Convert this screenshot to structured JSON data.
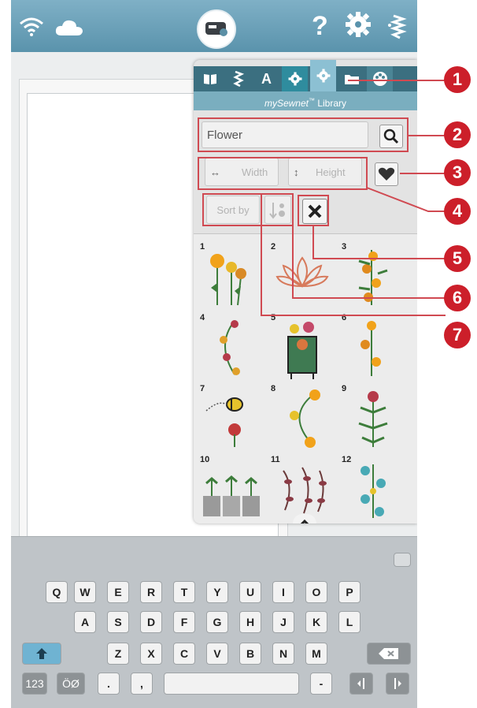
{
  "topbar": {
    "help_label": "?",
    "icons": [
      "wifi-icon",
      "cloud-icon",
      "machine-icon",
      "help-icon",
      "settings-icon",
      "stitch-icon"
    ]
  },
  "panel": {
    "tabs": [
      "book-icon",
      "stitch-icon",
      "A",
      "gear-icon",
      "gear-icon",
      "folder-icon",
      "palette-icon"
    ],
    "title_brand": "mySewnet",
    "title_tm": "™",
    "title_rest": " Library",
    "search": {
      "value": "Flower"
    },
    "width_label": "Width",
    "height_label": "Height",
    "sort_label": "Sort by",
    "designs": [
      "1",
      "2",
      "3",
      "4",
      "5",
      "6",
      "7",
      "8",
      "9",
      "10",
      "11",
      "12"
    ]
  },
  "callouts": [
    "1",
    "2",
    "3",
    "4",
    "5",
    "6",
    "7"
  ],
  "keyboard": {
    "row1": [
      "Q",
      "W",
      "E",
      "R",
      "T",
      "Y",
      "U",
      "I",
      "O",
      "P"
    ],
    "row2": [
      "A",
      "S",
      "D",
      "F",
      "G",
      "H",
      "J",
      "K",
      "L"
    ],
    "row3": [
      "Z",
      "X",
      "C",
      "V",
      "B",
      "N",
      "M"
    ],
    "numbers": "123",
    "special": "ÖØ",
    "dot": ".",
    "comma": ",",
    "dash": "-"
  },
  "colors": {
    "callout": "#cc1f2a",
    "tab_bar": "#3b6f80",
    "header": "#5a93ac"
  }
}
